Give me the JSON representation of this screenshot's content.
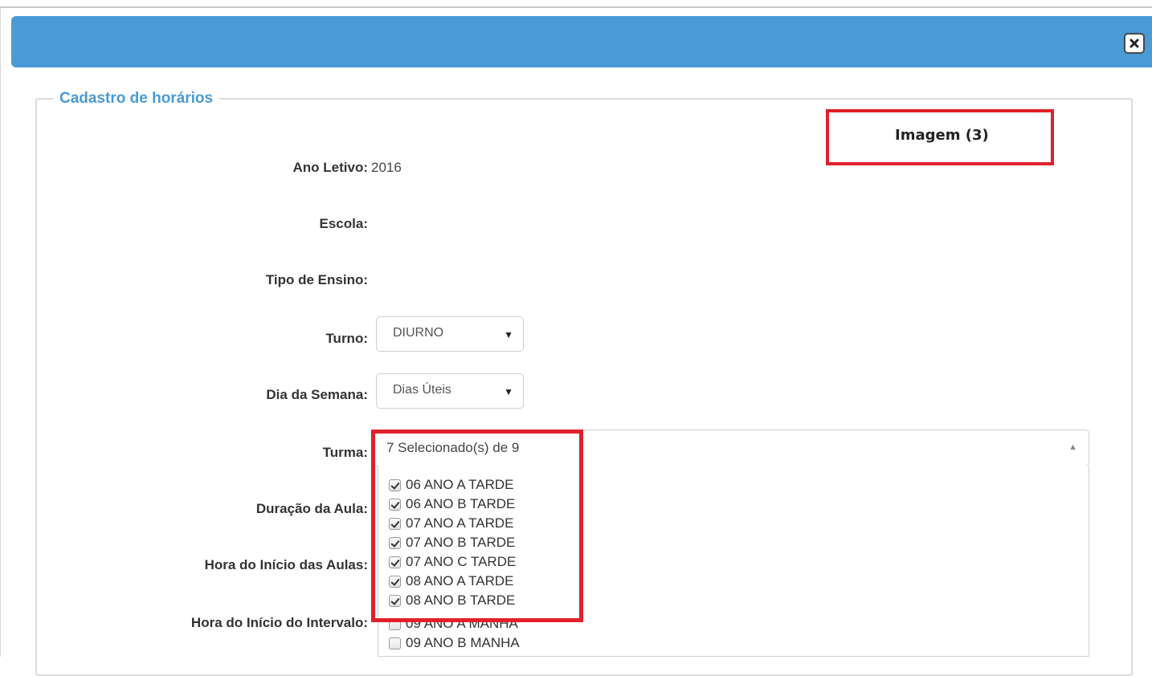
{
  "form": {
    "legend": "Cadastro de horários",
    "annotation": "Imagem (3)",
    "ano_letivo_label": "Ano Letivo:",
    "ano_letivo_value": "2016",
    "escola_label": "Escola:",
    "tipo_ensino_label": "Tipo de Ensino:",
    "turno_label": "Turno:",
    "turno_value": "DIURNO",
    "dia_label": "Dia da Semana:",
    "dia_value": "Dias Úteis",
    "turma_label": "Turma:",
    "turma_value": "7 Selecionado(s) de 9",
    "duracao_label": "Duração da Aula:",
    "hora_inicio_aulas_label": "Hora do Início das Aulas:",
    "hora_inicio_intervalo_label": "Hora do Início do Intervalo:"
  },
  "turma_options": [
    {
      "label": "06 ANO A TARDE",
      "checked": true
    },
    {
      "label": "06 ANO B TARDE",
      "checked": true
    },
    {
      "label": "07 ANO A TARDE",
      "checked": true
    },
    {
      "label": "07 ANO B TARDE",
      "checked": true
    },
    {
      "label": "07 ANO C TARDE",
      "checked": true
    },
    {
      "label": "08 ANO A TARDE",
      "checked": true
    },
    {
      "label": "08 ANO B TARDE",
      "checked": true
    },
    {
      "label": "09 ANO A MANHA",
      "checked": false
    },
    {
      "label": "09 ANO B MANHA",
      "checked": false
    }
  ],
  "colors": {
    "header": "#4a9ad6",
    "annotation": "#e0202a"
  }
}
